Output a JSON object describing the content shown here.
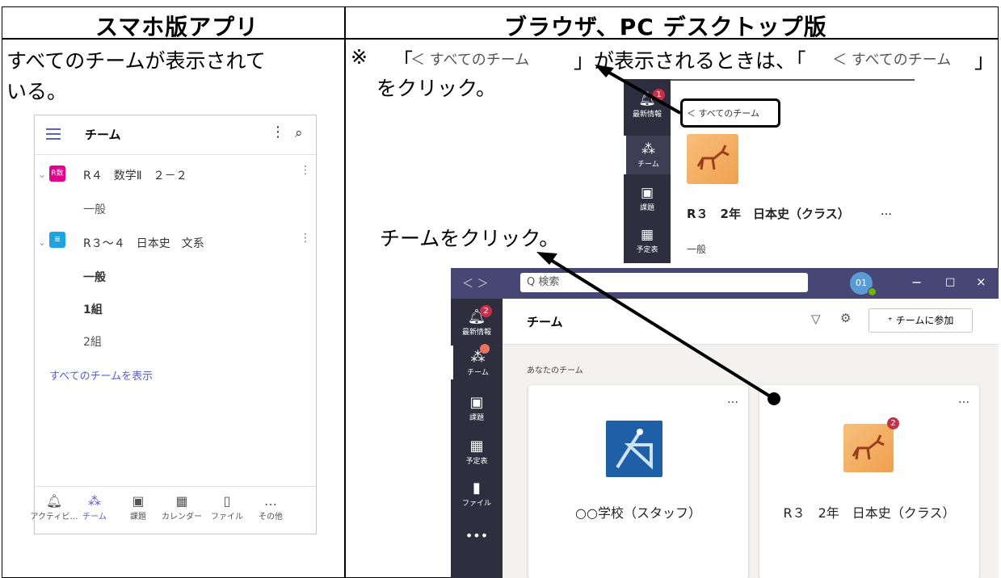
{
  "header_left": "スマホ版アプリ",
  "header_right": "ブラウザ、PC デスクトップ版",
  "left_desc_line1": "すべてのチームが表示されて",
  "left_desc_line2": "いる。",
  "right_note": {
    "mark": "※",
    "q_open": "「",
    "tag": "＜ すべてのチーム",
    "q_close_mid": "」が表示されるときは、「",
    "tag2": "＜ すべてのチーム",
    "q_close": "」",
    "line2": "をクリック。"
  },
  "click_team": "チームをクリック。",
  "phone": {
    "title": "チーム",
    "team1_badge": "R数",
    "team1": "R４　数学Ⅱ　２－２",
    "team1_channel": "一般",
    "team2": "R３～４　日本史　文系",
    "team2_channels": [
      "一般",
      "1組",
      "2組"
    ],
    "show_all": "すべてのチームを表示",
    "nav": [
      "アクティビ…",
      "チーム",
      "課題",
      "カレンダー",
      "ファイル",
      "その他"
    ]
  },
  "teams_small": {
    "back_link": "＜ すべてのチーム",
    "rail": [
      "最新情報",
      "チーム",
      "課題",
      "予定表"
    ],
    "notif_count": "1",
    "team_name": "R３　2年　日本史（クラス）",
    "more": "…",
    "channel": "一般"
  },
  "teams_big": {
    "nav_arrows": "＜ ＞",
    "search_placeholder": "Q 検索",
    "avatar": "01",
    "rail": [
      "最新情報",
      "チーム",
      "課題",
      "予定表",
      "ファイル"
    ],
    "activity_badge": "2",
    "header": "チーム",
    "join_button": "チームに参加",
    "section": "あなたのチーム",
    "card1": "○○学校（スタッフ）",
    "card2": "R３　2年　日本史（クラス）",
    "card2_badge": "2",
    "dots": "…"
  },
  "colors": {
    "brand": "#464775",
    "rail": "#2e2e3e",
    "badge_red": "#c4314b",
    "accent": "#5b5fc7"
  }
}
